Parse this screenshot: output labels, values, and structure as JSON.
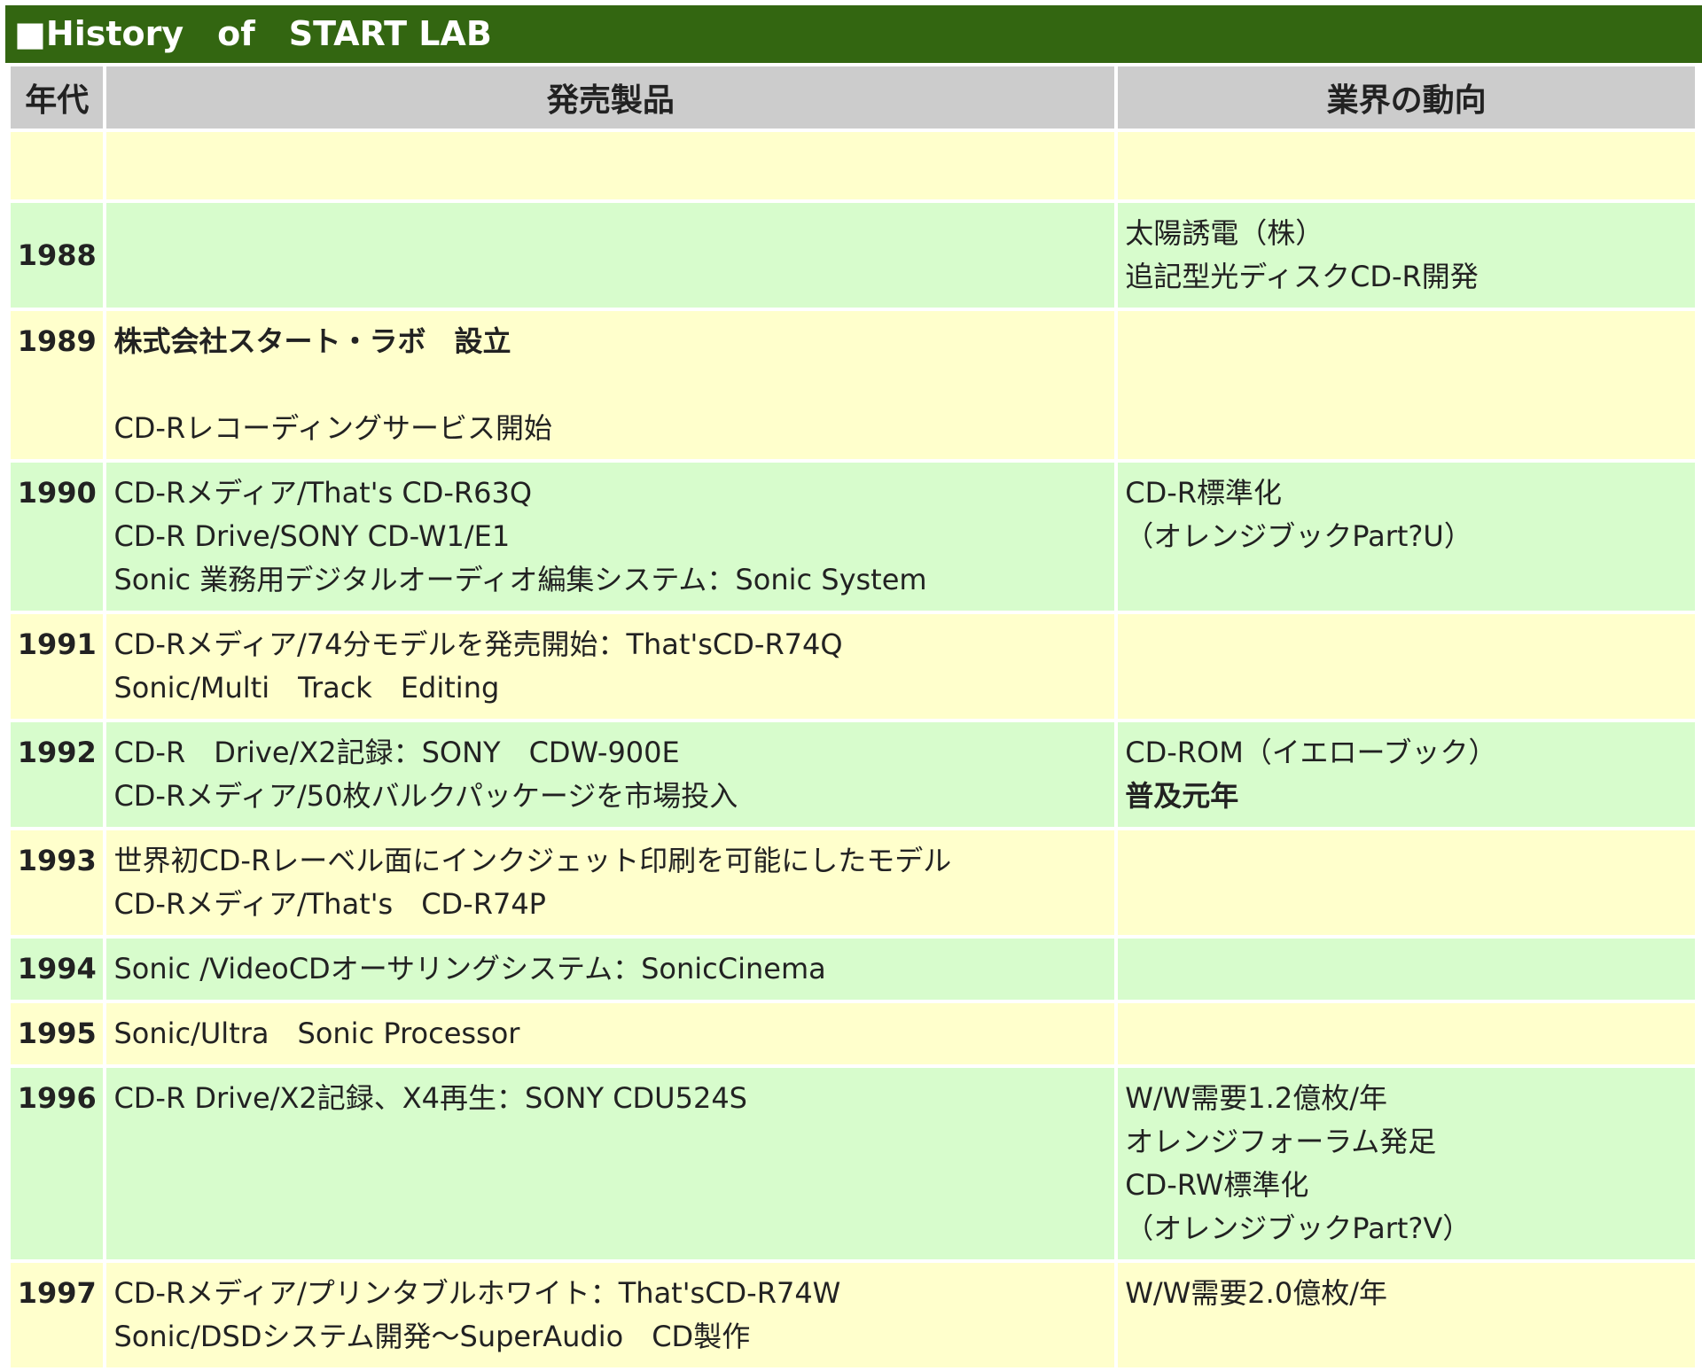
{
  "title": "■History　of　START LAB",
  "headers": {
    "year": "年代",
    "products": "発売製品",
    "industry": "業界の動向"
  },
  "rows": [
    {
      "year": "1988",
      "products": "",
      "industry": "太陽誘電（株）\n追記型光ディスクCD-R開発"
    },
    {
      "year": "1989",
      "products_bold": "株式会社スタート・ラボ　設立",
      "products": "CD-Rレコーディングサービス開始",
      "industry": ""
    },
    {
      "year": "1990",
      "products": "CD-Rメディア/That's CD-R63Q\nCD-R Drive/SONY CD-W1/E1\nSonic 業務用デジタルオーディオ編集システム：Sonic System",
      "industry": "CD-R標準化\n（オレンジブックPart?U）"
    },
    {
      "year": "1991",
      "products": "CD-Rメディア/74分モデルを発売開始：That'sCD-R74Q\nSonic/Multi　Track　Editing",
      "industry": ""
    },
    {
      "year": "1992",
      "products": "CD-R　Drive/X2記録：SONY　CDW-900E\nCD-Rメディア/50枚バルクパッケージを市場投入",
      "industry": "CD-ROM（イエローブック）",
      "industry_bold": "普及元年"
    },
    {
      "year": "1993",
      "products": "世界初CD-Rレーベル面にインクジェット印刷を可能にしたモデル\nCD-Rメディア/That's　CD-R74P",
      "industry": ""
    },
    {
      "year": "1994",
      "products": "Sonic /VideoCDオーサリングシステム：SonicCinema",
      "industry": ""
    },
    {
      "year": "1995",
      "products": "Sonic/Ultra　Sonic Processor",
      "industry": ""
    },
    {
      "year": "1996",
      "products": "CD-R Drive/X2記録、X4再生：SONY CDU524S",
      "industry": "W/W需要1.2億枚/年\nオレンジフォーラム発足\nCD-RW標準化\n（オレンジブックPart?V）"
    },
    {
      "year": "1997",
      "products": "CD-Rメディア/プリンタブルホワイト：That'sCD-R74W\nSonic/DSDシステム開発～SuperAudio　CD製作",
      "industry": "W/W需要2.0億枚/年"
    }
  ]
}
